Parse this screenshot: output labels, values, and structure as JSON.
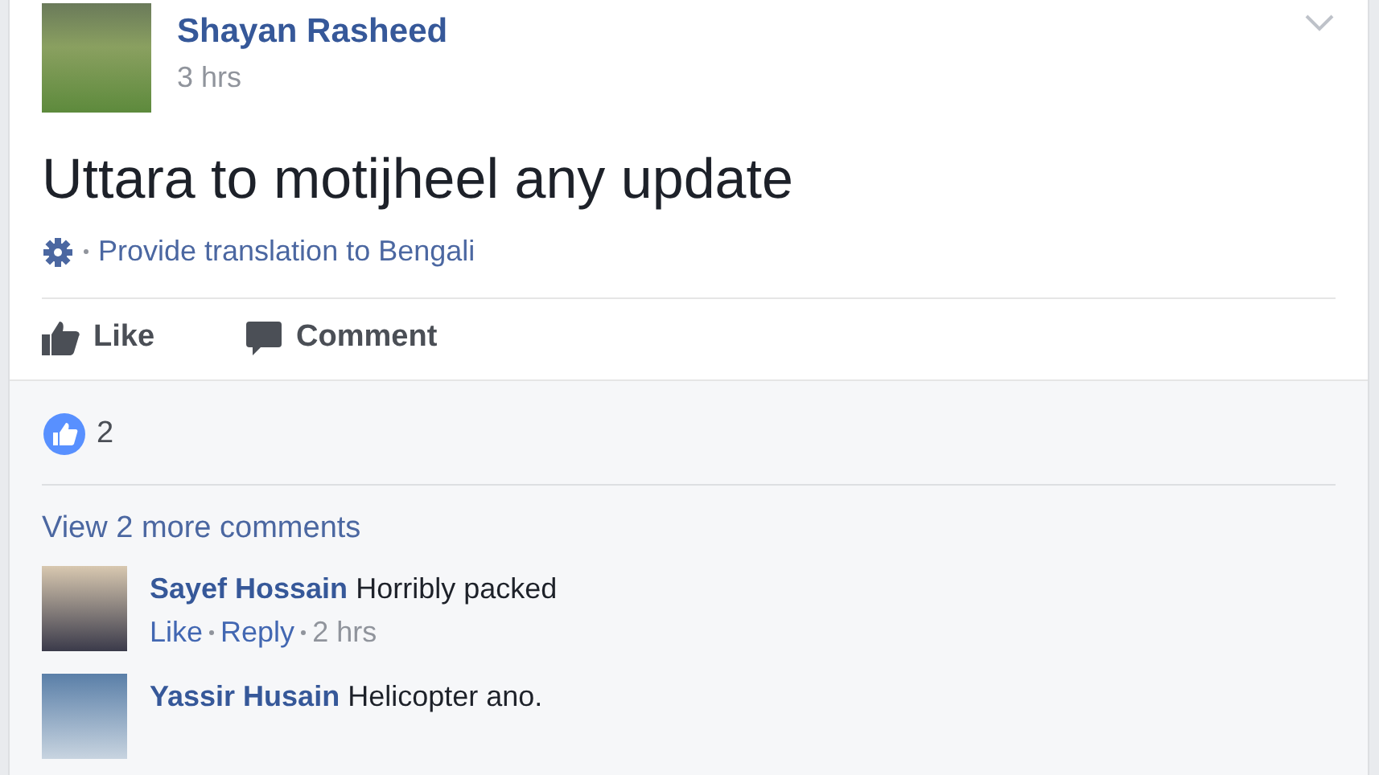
{
  "post": {
    "author": "Shayan Rasheed",
    "time": "3 hrs",
    "text": "Uttara to motijheel any update",
    "translation": "Provide translation to Bengali"
  },
  "actions": [
    "Like",
    "Comment"
  ],
  "reactions": {
    "count": "2"
  },
  "view_more": "View 2 more comments",
  "comments": [
    {
      "author": "Sayef Hossain",
      "text": "Horribly packed",
      "actions": [
        "Like",
        "Reply"
      ],
      "time": "2 hrs"
    },
    {
      "author": "Yassir Husain",
      "text": "Helicopter ano."
    }
  ]
}
